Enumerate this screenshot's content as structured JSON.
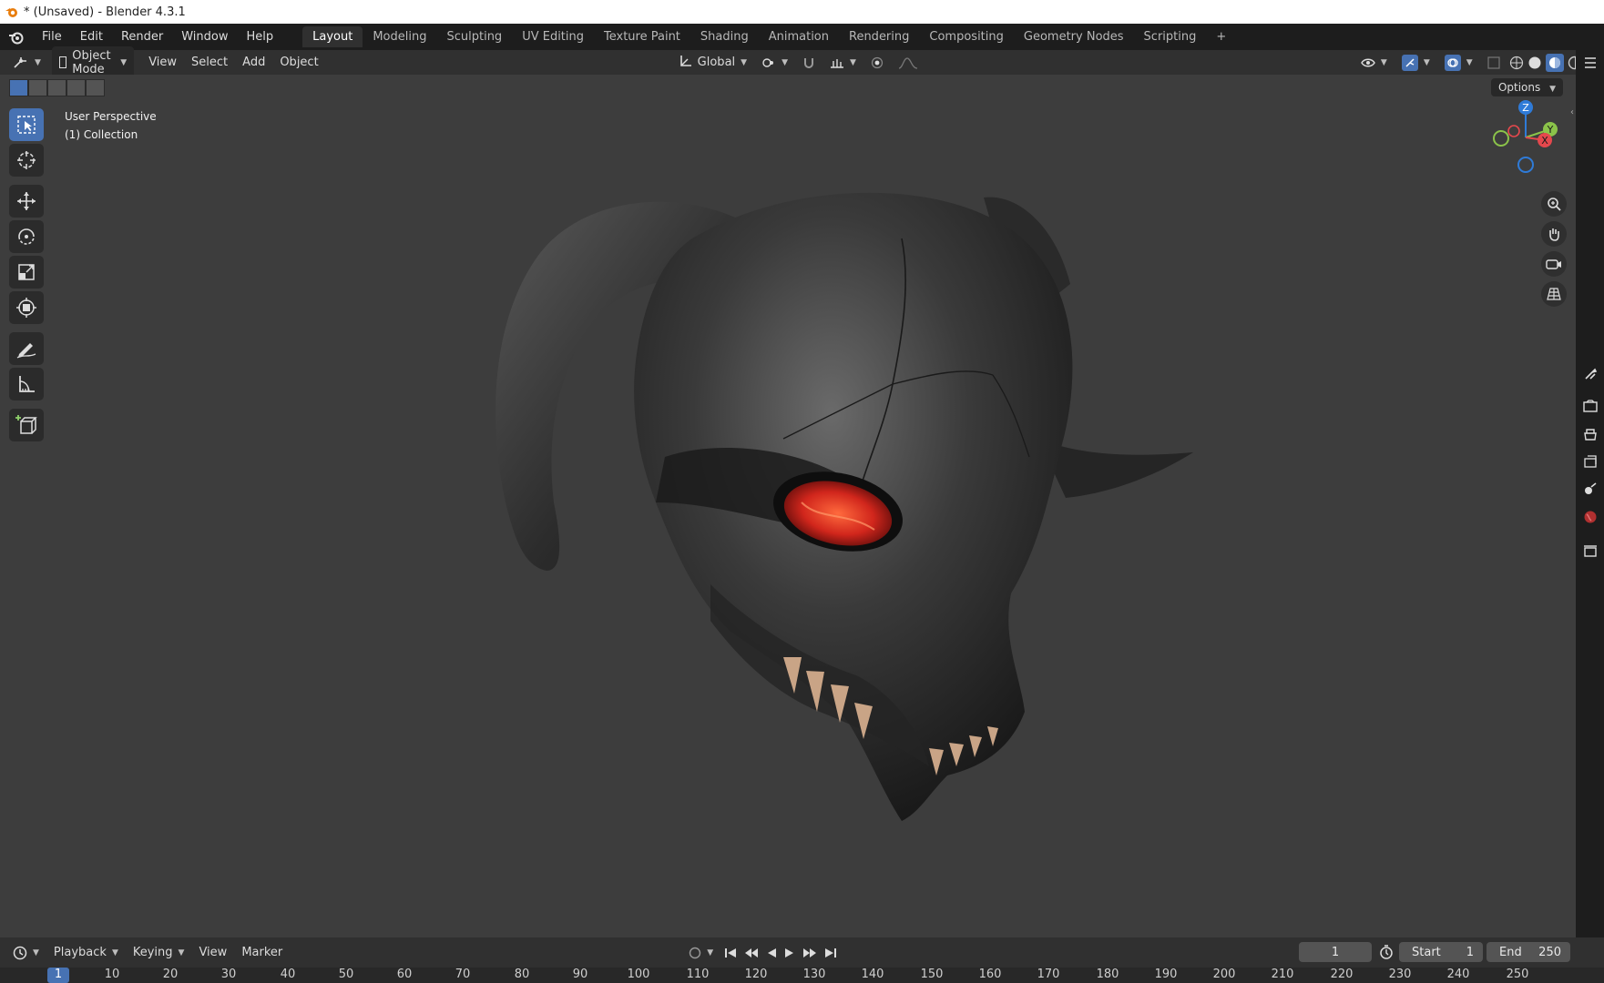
{
  "window": {
    "title": "* (Unsaved) - Blender 4.3.1"
  },
  "menu": {
    "items": [
      "File",
      "Edit",
      "Render",
      "Window",
      "Help"
    ],
    "workspaces": [
      "Layout",
      "Modeling",
      "Sculpting",
      "UV Editing",
      "Texture Paint",
      "Shading",
      "Animation",
      "Rendering",
      "Compositing",
      "Geometry Nodes",
      "Scripting"
    ],
    "active_workspace": "Layout",
    "add_tab": "+"
  },
  "header": {
    "mode": "Object Mode",
    "menus": [
      "View",
      "Select",
      "Add",
      "Object"
    ],
    "transform_orientation": "Global",
    "options_label": "Options"
  },
  "viewport": {
    "perspective": "User Perspective",
    "collection": "(1) Collection",
    "gizmo": {
      "z": "Z",
      "y": "Y",
      "x": "X"
    }
  },
  "toolbar": {
    "tools": [
      "select-box",
      "cursor",
      "move",
      "rotate",
      "scale",
      "transform",
      "annotate",
      "measure",
      "add-cube"
    ],
    "active_tool": "select-box"
  },
  "timeline": {
    "menus": [
      "Playback",
      "Keying",
      "View",
      "Marker"
    ],
    "current_frame": "1",
    "start_label": "Start",
    "start_value": "1",
    "end_label": "End",
    "end_value": "250",
    "ruler_current": "1",
    "ruler_ticks": [
      "10",
      "20",
      "30",
      "40",
      "50",
      "60",
      "70",
      "80",
      "90",
      "100",
      "110",
      "120",
      "130",
      "140",
      "150",
      "160",
      "170",
      "180",
      "190",
      "200",
      "210",
      "220",
      "230",
      "240",
      "250"
    ]
  },
  "colors": {
    "accent": "#4772b3",
    "viewport_bg": "#3d3d3d",
    "header_bg": "#303030",
    "axis_x": "#e5484d",
    "axis_y": "#8bc34a",
    "axis_z": "#2f7bd8"
  }
}
